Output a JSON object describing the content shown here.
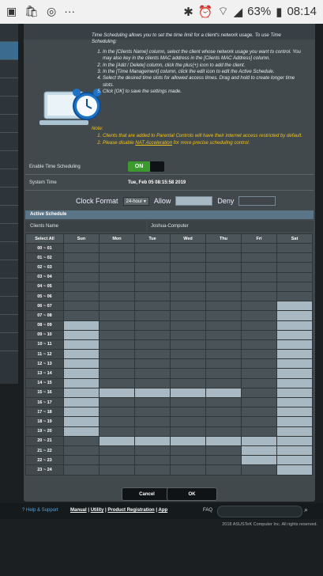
{
  "status": {
    "battery_pct": "63%",
    "time": "08:14",
    "left_icons": [
      "gallery-icon",
      "bag-icon",
      "instagram-icon",
      "more-icon"
    ],
    "right_icons": [
      "bluetooth-icon",
      "alarm-icon",
      "wifi-icon",
      "signal-icon",
      "battery-icon"
    ]
  },
  "intro": {
    "text": "Time Scheduling allows you to set the time limit for a client's network usage. To use Time Scheduling:",
    "steps": [
      "In the [Clients Name] column, select the client whose network usage you want to control. You may also key in the clients MAC address in the [Clients MAC Address] column.",
      "In the [Add / Delete] column, click the plus(+) icon to add the client.",
      "In the [Time Management] column, click the edit icon to edit the Active Schedule.",
      "Select the desired time slots for allowed access times. Drag and hold to create longer time slots.",
      "Click [OK] to save the settings made."
    ]
  },
  "notes": {
    "title": "Note:",
    "items": [
      "Clients that are added to Parental Controls will have their internet access restricted by default.",
      "Please disable NAT Acceleration for more precise scheduling control."
    ],
    "link": "NAT Acceleration"
  },
  "settings": {
    "enable_label": "Enable Time Scheduling",
    "toggle_on": "ON",
    "system_time_label": "System Time",
    "system_time_value": "Tue, Feb 05 08:15:58 2019"
  },
  "format": {
    "label": "Clock Format",
    "value": "24-hour",
    "allow": "Allow",
    "deny": "Deny"
  },
  "schedule": {
    "title": "Active Schedule",
    "clients_label": "Clients Name",
    "client_value": "Joshua-Computer",
    "select_all": "Select All",
    "days": [
      "Sun",
      "Mon",
      "Tue",
      "Wed",
      "Thu",
      "Fri",
      "Sat"
    ],
    "hours": [
      "00 ~ 01",
      "01 ~ 02",
      "02 ~ 03",
      "03 ~ 04",
      "04 ~ 05",
      "05 ~ 06",
      "06 ~ 07",
      "07 ~ 08",
      "08 ~ 09",
      "09 ~ 10",
      "10 ~ 11",
      "11 ~ 12",
      "12 ~ 13",
      "13 ~ 14",
      "14 ~ 15",
      "15 ~ 16",
      "16 ~ 17",
      "17 ~ 18",
      "18 ~ 19",
      "19 ~ 20",
      "20 ~ 21",
      "21 ~ 22",
      "22 ~ 23",
      "23 ~ 24"
    ],
    "allowed": [
      [
        0,
        0,
        0,
        0,
        0,
        0,
        0
      ],
      [
        0,
        0,
        0,
        0,
        0,
        0,
        0
      ],
      [
        0,
        0,
        0,
        0,
        0,
        0,
        0
      ],
      [
        0,
        0,
        0,
        0,
        0,
        0,
        0
      ],
      [
        0,
        0,
        0,
        0,
        0,
        0,
        0
      ],
      [
        0,
        0,
        0,
        0,
        0,
        0,
        0
      ],
      [
        0,
        0,
        0,
        0,
        0,
        0,
        1
      ],
      [
        0,
        0,
        0,
        0,
        0,
        0,
        1
      ],
      [
        1,
        0,
        0,
        0,
        0,
        0,
        1
      ],
      [
        1,
        0,
        0,
        0,
        0,
        0,
        1
      ],
      [
        1,
        0,
        0,
        0,
        0,
        0,
        1
      ],
      [
        1,
        0,
        0,
        0,
        0,
        0,
        1
      ],
      [
        1,
        0,
        0,
        0,
        0,
        0,
        1
      ],
      [
        1,
        0,
        0,
        0,
        0,
        0,
        1
      ],
      [
        1,
        0,
        0,
        0,
        0,
        0,
        1
      ],
      [
        1,
        1,
        1,
        1,
        1,
        0,
        1
      ],
      [
        1,
        0,
        0,
        0,
        0,
        0,
        1
      ],
      [
        1,
        0,
        0,
        0,
        0,
        0,
        1
      ],
      [
        1,
        0,
        0,
        0,
        0,
        0,
        1
      ],
      [
        1,
        0,
        0,
        0,
        0,
        0,
        1
      ],
      [
        0,
        1,
        1,
        1,
        1,
        1,
        1
      ],
      [
        0,
        0,
        0,
        0,
        0,
        1,
        1
      ],
      [
        0,
        0,
        0,
        0,
        0,
        1,
        1
      ],
      [
        0,
        0,
        0,
        0,
        0,
        0,
        1
      ]
    ]
  },
  "buttons": {
    "cancel": "Cancel",
    "ok": "OK"
  },
  "footer": {
    "help": "Help & Support",
    "manual": "Manual",
    "utility": "Utility",
    "registration": "Product Registration",
    "app": "App",
    "faq": "FAQ",
    "copyright": "2018 ASUSTeK Computer Inc. All rights reserved."
  },
  "colors": {
    "allowed": "#a9b9c3",
    "denied": "#4a5357",
    "toggle_on": "#3c9b2f",
    "note": "#f0c419"
  }
}
